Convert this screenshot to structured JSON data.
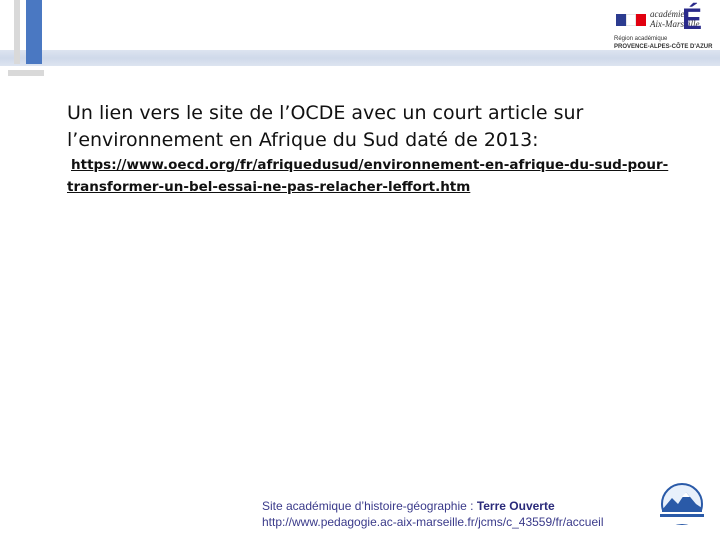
{
  "header": {
    "logo": {
      "line1": "académie",
      "line2": "Aix-Marseille",
      "letter": "É",
      "sub1": "Région académique",
      "sub2": "PROVENCE-ALPES-CÔTE D'AZUR",
      "flag_colors": [
        "#2b3b8f",
        "#ffffff",
        "#e1000f"
      ]
    }
  },
  "main": {
    "text": "Un lien vers le site de l’OCDE avec  un court article sur l’environnement en Afrique du Sud daté de 2013:",
    "link_line1": "https://www.oecd.org/fr/afriquedusud/environnement-en-afrique-du-sud-pour-",
    "link_line2": "transformer-un-bel-essai-ne-pas-relacher-leffort.htm"
  },
  "footer": {
    "line1_prefix": "Site académique d’histoire-géographie : ",
    "line1_bold": "Terre Ouverte",
    "line2": "http://www.pedagogie.ac-aix-marseille.fr/jcms/c_43559/fr/accueil"
  }
}
